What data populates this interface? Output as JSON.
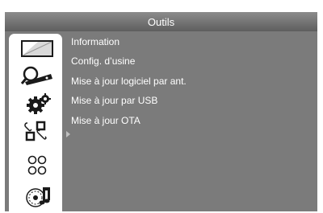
{
  "header": {
    "title": "Outils"
  },
  "sidebar": {
    "icons": [
      "monitor-icon",
      "satellite-receiver-icon",
      "gears-icon",
      "tools-settings-icon",
      "four-circles-icon",
      "music-disc-icon"
    ]
  },
  "menu": {
    "items": [
      {
        "label": "Information"
      },
      {
        "label": "Config. d’usine"
      },
      {
        "label": "Mise à jour logiciel par ant."
      },
      {
        "label": "Mise à jour par USB"
      },
      {
        "label": "Mise à jour OTA"
      }
    ]
  },
  "colors": {
    "background": "#7b7b7b",
    "title_bar_top": "#8c8c8c",
    "title_bar_bottom": "#5e5e5e",
    "sidebar": "#ffffff",
    "text": "#ffffff"
  }
}
